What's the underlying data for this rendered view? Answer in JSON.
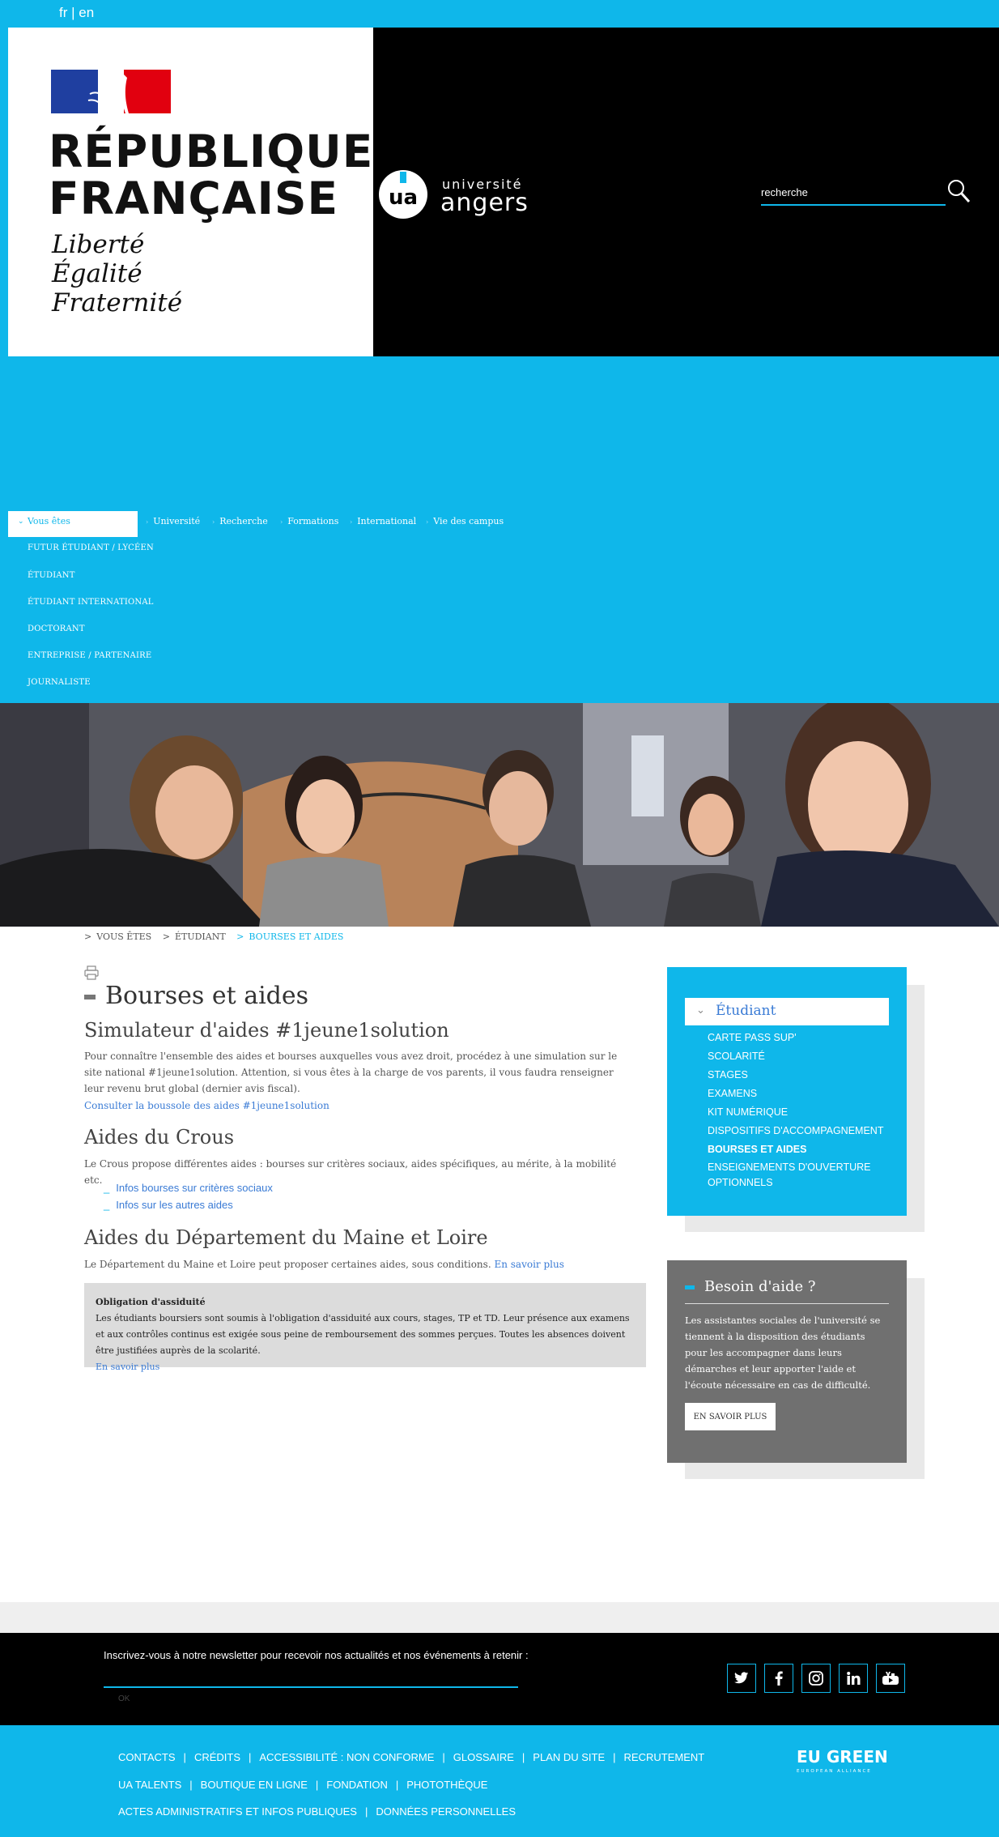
{
  "lang": {
    "fr": "fr",
    "sep": "|",
    "en": "en"
  },
  "header": {
    "rf_line1": "RÉPUBLIQUE",
    "rf_line2": "FRANÇAISE",
    "motto1": "Liberté",
    "motto2": "Égalité",
    "motto3": "Fraternité",
    "ua_small": "université",
    "ua_big": "angers",
    "search_placeholder": "recherche"
  },
  "nav": {
    "active": "Vous êtes",
    "items": [
      "Université",
      "Recherche",
      "Formations",
      "International",
      "Vie des campus"
    ],
    "sub": [
      "FUTUR ÉTUDIANT / LYCÉEN",
      "ÉTUDIANT",
      "ÉTUDIANT INTERNATIONAL",
      "DOCTORANT",
      "ENTREPRISE / PARTENAIRE",
      "JOURNALISTE"
    ]
  },
  "breadcrumb": {
    "b1": "VOUS ÊTES",
    "b2": "ÉTUDIANT",
    "b3": "BOURSES ET AIDES"
  },
  "main": {
    "title": "Bourses et aides",
    "s1_title": "Simulateur d'aides #1jeune1solution",
    "s1_text": "Pour connaître l'ensemble des aides et bourses auxquelles vous avez droit, procédez à une simulation sur le site national #1jeune1solution. Attention, si vous êtes à la charge de vos parents, il vous faudra renseigner leur revenu brut global (dernier avis fiscal).",
    "s1_link": "Consulter la boussole des aides #1jeune1solution",
    "s2_title": "Aides du Crous",
    "s2_text": "Le Crous propose différentes aides : bourses sur critères sociaux, aides spécifiques, au mérite, à la mobilité etc.",
    "s2_link1": "Infos bourses sur critères sociaux",
    "s2_link2": "Infos sur les autres aides",
    "s3_title": "Aides du Département du Maine et Loire",
    "s3_text": "Le Département du Maine et Loire peut proposer certaines aides, sous conditions.",
    "s3_link": "En savoir plus",
    "notice_title": "Obligation d'assiduité",
    "notice_text": "Les étudiants boursiers sont soumis à l'obligation d'assiduité aux cours, stages, TP et TD. Leur présence aux examens et aux contrôles continus est exigée sous peine de remboursement des sommes perçues. Toutes les absences doivent être justifiées auprès de la scolarité.",
    "notice_link": "En savoir plus"
  },
  "sidebar": {
    "head": "Étudiant",
    "links": [
      "CARTE PASS SUP'",
      "SCOLARITÉ",
      "STAGES",
      "EXAMENS",
      "KIT NUMÉRIQUE",
      "DISPOSITIFS D'ACCOMPAGNEMENT",
      "BOURSES ET AIDES",
      "ENSEIGNEMENTS D'OUVERTURE OPTIONNELS"
    ],
    "active_index": 6,
    "help_title": "Besoin d'aide ?",
    "help_text": "Les assistantes sociales de l'université se tiennent à la disposition des étudiants pour les accompagner dans leurs démarches et leur apporter l'aide et l'écoute nécessaire en cas de difficulté.",
    "help_button": "EN SAVOIR PLUS"
  },
  "footer": {
    "newsletter_label": "Inscrivez-vous à notre newsletter pour recevoir nos actualités et nos événements à retenir :",
    "ok": "OK",
    "social": [
      "twitter-icon",
      "facebook-icon",
      "instagram-icon",
      "linkedin-icon",
      "youtube-icon"
    ],
    "links_row1": [
      "CONTACTS",
      "CRÉDITS",
      "ACCESSIBILITÉ : NON CONFORME",
      "GLOSSAIRE",
      "PLAN DU SITE",
      "RECRUTEMENT"
    ],
    "links_row2": [
      "UA TALENTS",
      "BOUTIQUE EN LIGNE",
      "FONDATION",
      "PHOTOTHÈQUE"
    ],
    "links_row3": [
      "ACTES ADMINISTRATIFS ET INFOS PUBLIQUES",
      "DONNÉES PERSONNELLES"
    ],
    "eu_green": "EU GREEN",
    "eu_green_sub": "EUROPEAN ALLIANCE"
  },
  "colors": {
    "accent": "#0fb7ea",
    "link": "#3a7bd5",
    "dark": "#000000",
    "grey_box": "#707070"
  }
}
